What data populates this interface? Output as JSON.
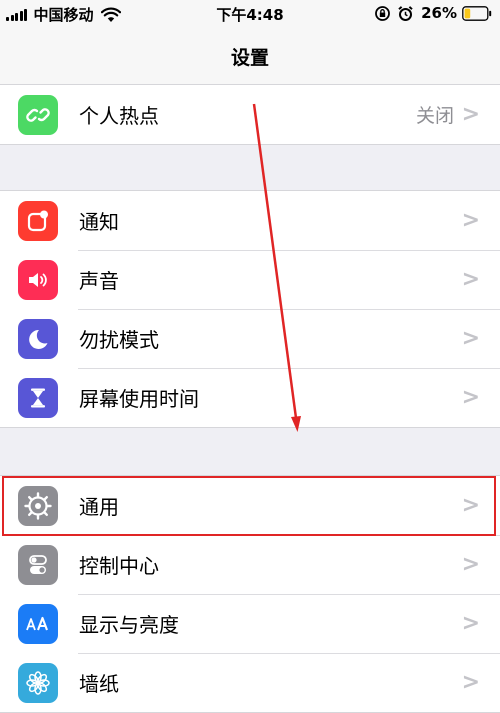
{
  "status": {
    "carrier": "中国移动",
    "time": "下午4:48",
    "battery_percent": "26%",
    "battery_level": 0.26
  },
  "nav": {
    "title": "设置"
  },
  "groups": [
    [
      {
        "label": "个人热点",
        "value": "关闭",
        "icon": "hotspot-icon",
        "color": "#4cd964"
      }
    ],
    [
      {
        "label": "通知",
        "icon": "notifications-icon",
        "color": "#fe3b30"
      },
      {
        "label": "声音",
        "icon": "speaker-icon",
        "color": "#fe2d55"
      },
      {
        "label": "勿扰模式",
        "icon": "moon-icon",
        "color": "#5856d6"
      },
      {
        "label": "屏幕使用时间",
        "icon": "hourglass-icon",
        "color": "#5856d6"
      }
    ],
    [
      {
        "label": "通用",
        "icon": "gear-icon",
        "color": "#8e8e93"
      },
      {
        "label": "控制中心",
        "icon": "toggles-icon",
        "color": "#8e8e93"
      },
      {
        "label": "显示与亮度",
        "icon": "text-size-icon",
        "color": "#1b7cf6"
      },
      {
        "label": "墙纸",
        "icon": "flower-icon",
        "color": "#35aadc"
      }
    ]
  ],
  "colors": {
    "annotation": "#e02525"
  }
}
